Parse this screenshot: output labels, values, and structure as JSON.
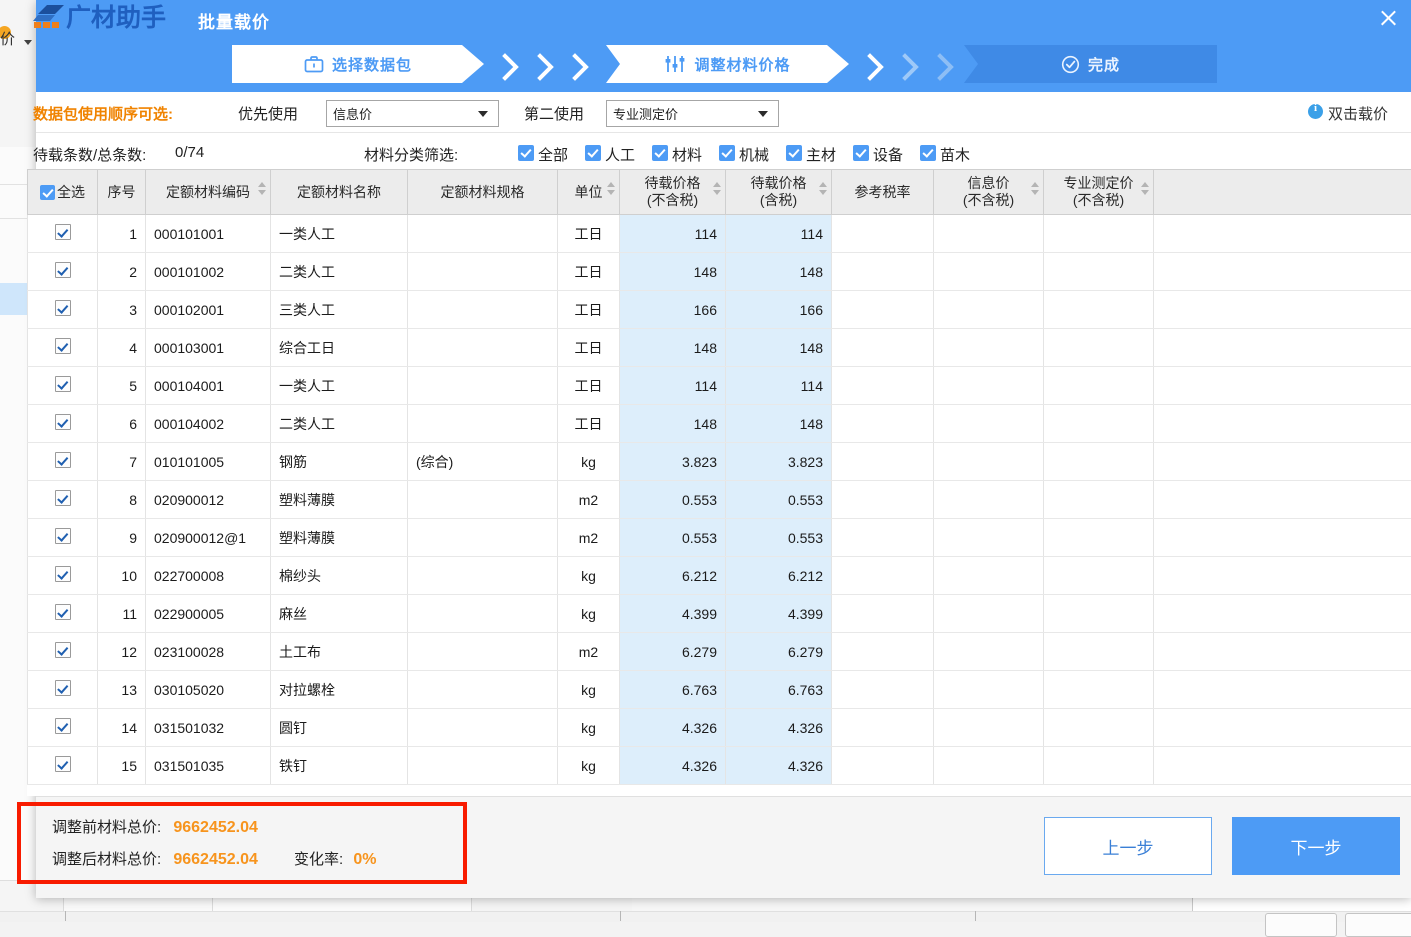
{
  "background": {
    "left_toolbar_label": "价",
    "dot_icon": "orange-dot-icon"
  },
  "dialog": {
    "brand": "广材助手",
    "title": "批量载价",
    "close_icon": "close-icon"
  },
  "steps": [
    {
      "label": "选择数据包",
      "icon": "briefcase-icon",
      "state": "done"
    },
    {
      "label": "调整材料价格",
      "icon": "sliders-icon",
      "state": "active"
    },
    {
      "label": "完成",
      "icon": "check-circle-icon",
      "state": "future"
    }
  ],
  "filters": {
    "order_label": "数据包使用顺序可选:",
    "primary_label": "优先使用",
    "primary_value": "信息价",
    "secondary_label": "第二使用",
    "secondary_value": "专业测定价",
    "hint_icon": "info-icon",
    "hint_text": "双击载价",
    "count_label": "待载条数/总条数:",
    "count_value": "0/74",
    "category_label": "材料分类筛选:",
    "categories": [
      {
        "label": "全部",
        "checked": true
      },
      {
        "label": "人工",
        "checked": true
      },
      {
        "label": "材料",
        "checked": true
      },
      {
        "label": "机械",
        "checked": true
      },
      {
        "label": "主材",
        "checked": true
      },
      {
        "label": "设备",
        "checked": true
      },
      {
        "label": "苗木",
        "checked": true
      }
    ]
  },
  "table": {
    "select_all_label": "全选",
    "select_all_checked": true,
    "columns": [
      {
        "label": "全选",
        "sortable": false
      },
      {
        "label": "序号",
        "sortable": false
      },
      {
        "label": "定额材料编码",
        "sortable": true
      },
      {
        "label": "定额材料名称",
        "sortable": false
      },
      {
        "label": "定额材料规格",
        "sortable": false
      },
      {
        "label": "单位",
        "sortable": true
      },
      {
        "label": "待载价格",
        "label2": "(不含税)",
        "sortable": true
      },
      {
        "label": "待载价格",
        "label2": "(含税)",
        "sortable": true
      },
      {
        "label": "参考税率",
        "sortable": false
      },
      {
        "label": "信息价",
        "label2": "(不含税)",
        "sortable": true
      },
      {
        "label": "专业测定价",
        "label2": "(不含税)",
        "sortable": true
      },
      {
        "label": "",
        "sortable": false
      }
    ],
    "rows": [
      {
        "checked": true,
        "no": "1",
        "code": "000101001",
        "name": "一类人工",
        "spec": "",
        "unit": "工日",
        "price_ex": "114",
        "price_in": "114",
        "tax": "",
        "info_price": "",
        "pro_price": ""
      },
      {
        "checked": true,
        "no": "2",
        "code": "000101002",
        "name": "二类人工",
        "spec": "",
        "unit": "工日",
        "price_ex": "148",
        "price_in": "148",
        "tax": "",
        "info_price": "",
        "pro_price": ""
      },
      {
        "checked": true,
        "no": "3",
        "code": "000102001",
        "name": "三类人工",
        "spec": "",
        "unit": "工日",
        "price_ex": "166",
        "price_in": "166",
        "tax": "",
        "info_price": "",
        "pro_price": ""
      },
      {
        "checked": true,
        "no": "4",
        "code": "000103001",
        "name": "综合工日",
        "spec": "",
        "unit": "工日",
        "price_ex": "148",
        "price_in": "148",
        "tax": "",
        "info_price": "",
        "pro_price": ""
      },
      {
        "checked": true,
        "no": "5",
        "code": "000104001",
        "name": "一类人工",
        "spec": "",
        "unit": "工日",
        "price_ex": "114",
        "price_in": "114",
        "tax": "",
        "info_price": "",
        "pro_price": ""
      },
      {
        "checked": true,
        "no": "6",
        "code": "000104002",
        "name": "二类人工",
        "spec": "",
        "unit": "工日",
        "price_ex": "148",
        "price_in": "148",
        "tax": "",
        "info_price": "",
        "pro_price": ""
      },
      {
        "checked": true,
        "no": "7",
        "code": "010101005",
        "name": "钢筋",
        "spec": "(综合)",
        "unit": "kg",
        "price_ex": "3.823",
        "price_in": "3.823",
        "tax": "",
        "info_price": "",
        "pro_price": ""
      },
      {
        "checked": true,
        "no": "8",
        "code": "020900012",
        "name": "塑料薄膜",
        "spec": "",
        "unit": "m2",
        "price_ex": "0.553",
        "price_in": "0.553",
        "tax": "",
        "info_price": "",
        "pro_price": ""
      },
      {
        "checked": true,
        "no": "9",
        "code": "020900012@1",
        "name": "塑料薄膜",
        "spec": "",
        "unit": "m2",
        "price_ex": "0.553",
        "price_in": "0.553",
        "tax": "",
        "info_price": "",
        "pro_price": ""
      },
      {
        "checked": true,
        "no": "10",
        "code": "022700008",
        "name": "棉纱头",
        "spec": "",
        "unit": "kg",
        "price_ex": "6.212",
        "price_in": "6.212",
        "tax": "",
        "info_price": "",
        "pro_price": ""
      },
      {
        "checked": true,
        "no": "11",
        "code": "022900005",
        "name": "麻丝",
        "spec": "",
        "unit": "kg",
        "price_ex": "4.399",
        "price_in": "4.399",
        "tax": "",
        "info_price": "",
        "pro_price": ""
      },
      {
        "checked": true,
        "no": "12",
        "code": "023100028",
        "name": "土工布",
        "spec": "",
        "unit": "m2",
        "price_ex": "6.279",
        "price_in": "6.279",
        "tax": "",
        "info_price": "",
        "pro_price": ""
      },
      {
        "checked": true,
        "no": "13",
        "code": "030105020",
        "name": "对拉螺栓",
        "spec": "",
        "unit": "kg",
        "price_ex": "6.763",
        "price_in": "6.763",
        "tax": "",
        "info_price": "",
        "pro_price": ""
      },
      {
        "checked": true,
        "no": "14",
        "code": "031501032",
        "name": "圆钉",
        "spec": "",
        "unit": "kg",
        "price_ex": "4.326",
        "price_in": "4.326",
        "tax": "",
        "info_price": "",
        "pro_price": ""
      },
      {
        "checked": true,
        "no": "15",
        "code": "031501035",
        "name": "铁钉",
        "spec": "",
        "unit": "kg",
        "price_ex": "4.326",
        "price_in": "4.326",
        "tax": "",
        "info_price": "",
        "pro_price": ""
      }
    ]
  },
  "footer": {
    "before_label": "调整前材料总价:",
    "before_value": "9662452.04",
    "after_label": "调整后材料总价:",
    "after_value": "9662452.04",
    "rate_label": "变化率:",
    "rate_value": "0%",
    "prev_label": "上一步",
    "next_label": "下一步"
  },
  "colors": {
    "accent": "#4d9bf5",
    "orange": "#f7941d",
    "highlight_red": "#f81b00",
    "price_cell": "#ddeefb"
  }
}
